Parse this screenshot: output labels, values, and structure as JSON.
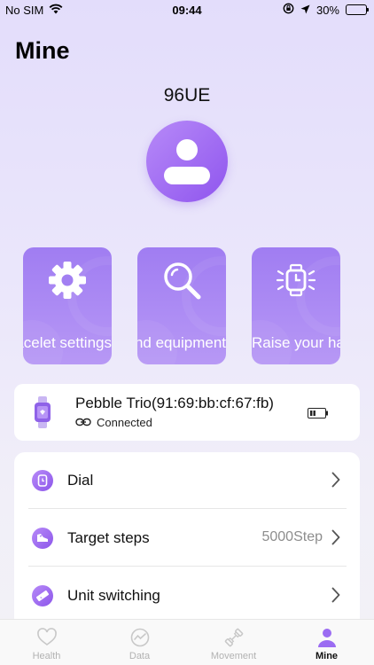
{
  "status_bar": {
    "carrier": "No SIM",
    "time": "09:44",
    "battery_percent": "30%",
    "battery_level": 0.3,
    "icons": [
      "wifi-icon",
      "rotation-lock-icon",
      "location-arrow-icon",
      "battery-icon"
    ]
  },
  "page": {
    "title": "Mine",
    "user_name": "96UE"
  },
  "tiles": [
    {
      "label": "Bracelet settings",
      "icon": "gear-icon"
    },
    {
      "label": "Find equipment",
      "icon": "search-icon"
    },
    {
      "label": "Raise your hand to light",
      "icon": "smartwatch-icon"
    }
  ],
  "device": {
    "name": "Pebble Trio(91:69:bb:cf:67:fb)",
    "status": "Connected",
    "icons": [
      "watch-icon",
      "link-icon",
      "battery-low-icon"
    ]
  },
  "menu": [
    {
      "label": "Dial",
      "value": "",
      "icon": "watch-face-icon"
    },
    {
      "label": "Target steps",
      "value": "5000Step",
      "icon": "sneaker-icon"
    },
    {
      "label": "Unit switching",
      "value": "",
      "icon": "ruler-icon"
    }
  ],
  "tab_bar": {
    "tabs": [
      {
        "label": "Health",
        "icon": "heart-icon",
        "active": false
      },
      {
        "label": "Data",
        "icon": "chart-circle-icon",
        "active": false
      },
      {
        "label": "Movement",
        "icon": "dumbbell-icon",
        "active": false
      },
      {
        "label": "Mine",
        "icon": "person-icon",
        "active": true
      }
    ]
  },
  "colors": {
    "accent": "#9b6cf2",
    "tile_top": "#a07df2",
    "tile_bottom": "#b798f5",
    "background_top": "#e3ddfb"
  }
}
